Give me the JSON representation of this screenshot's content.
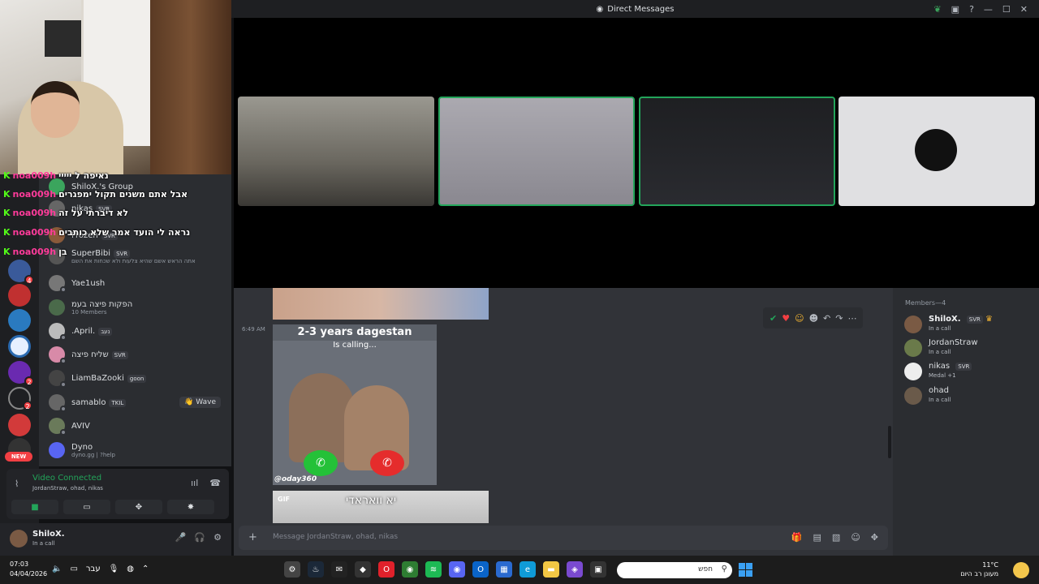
{
  "titlebar": {
    "title": "Direct Messages"
  },
  "stream_chat": [
    {
      "user": "noa009h",
      "message": "נאיפה ל ייייי"
    },
    {
      "user": "noa009h",
      "message": "אבל אתם משנים תקול ימפגרים"
    },
    {
      "user": "noa009h",
      "message": "לא דיברתי על זה"
    },
    {
      "user": "noa009h",
      "message": "נראה לי הועד אמר שלא כותבים"
    },
    {
      "user": "noa009h",
      "message": "בן"
    }
  ],
  "dm_list": [
    {
      "name": "ShiloX.'s Group",
      "sub": ""
    },
    {
      "name": "nikas",
      "tag": "SVR",
      "sub": ""
    },
    {
      "name": "Frozen",
      "tag": "SVR",
      "sub": ""
    },
    {
      "name": "SuperBibi",
      "tag": "SVR",
      "sub": "אתה הראש אשם שהיא צלעות ולא שכחות את השם"
    },
    {
      "name": "Yae1ush",
      "sub": ""
    },
    {
      "name": "הפקות פיצה בעמ",
      "sub": "10 Members"
    },
    {
      "name": ".April.",
      "tag": "נעב",
      "sub": ""
    },
    {
      "name": "שליח פיצה",
      "tag": "SVR",
      "sub": ""
    },
    {
      "name": "LiamBaZooki",
      "tag": "goon",
      "sub": ""
    },
    {
      "name": "samablo",
      "tag": "TKIL",
      "sub": "",
      "action": "Wave"
    },
    {
      "name": "AVIV",
      "sub": ""
    },
    {
      "name": "Dyno",
      "sub": "dyno.gg | ?help"
    }
  ],
  "servers": {
    "badges": [
      "4",
      "2",
      "2"
    ],
    "new_label": "NEW"
  },
  "voice": {
    "status": "Video Connected",
    "channel": "JordanStraw, ohad, nikas"
  },
  "user_panel": {
    "name": "ShiloX.",
    "status": "In a call"
  },
  "chat": {
    "timestamp": "6:49 AM",
    "meme_title": "2-3 years dagestan",
    "meme_caption": "Is calling...",
    "meme_credit": "@oday360",
    "gif_label": "GIF",
    "gif_text": "יא וואראדי",
    "composer_placeholder": "Message JordanStraw, ohad, nikas"
  },
  "members": {
    "header": "Members—4",
    "list": [
      {
        "name": "ShiloX.",
        "tag": "SVR",
        "status": "In a call",
        "color": "#f2f3f5"
      },
      {
        "name": "JordanStraw",
        "status": "In a call"
      },
      {
        "name": "nikas",
        "tag": "SVR",
        "status": "Medal +1"
      },
      {
        "name": "ohad",
        "status": "In a call"
      }
    ]
  },
  "taskbar": {
    "time": "07:03",
    "date": "04/04/2026",
    "lang": "עבר",
    "search_placeholder": "חפש",
    "temp": "11°C",
    "weather": "מעונן רב היום"
  },
  "colors": {
    "green": "#23a55a",
    "red": "#f23f43",
    "bg": "#313338"
  }
}
